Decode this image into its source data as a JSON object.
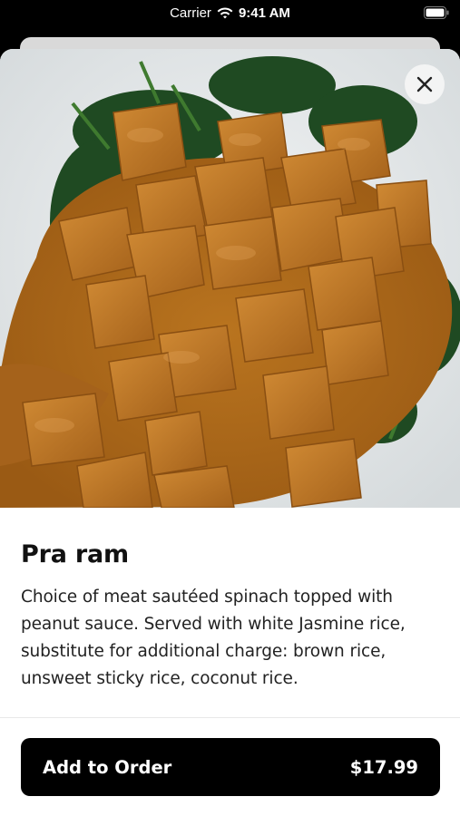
{
  "status_bar": {
    "carrier": "Carrier",
    "time": "9:41 AM",
    "wifi_icon": "wifi-icon",
    "battery_icon": "battery-icon"
  },
  "item": {
    "title": "Pra ram",
    "description": "Choice of meat sautéed spinach topped with peanut sauce. Served with white Jasmine rice, substitute for additional charge: brown rice, unsweet sticky rice, coconut rice.",
    "image_icon": "food-photo"
  },
  "close_button": {
    "icon": "close-icon"
  },
  "order_button": {
    "label": "Add to Order",
    "price": "$17.99"
  },
  "colors": {
    "background": "#000000",
    "sheet": "#ffffff",
    "button": "#000000",
    "button_text": "#ffffff"
  }
}
